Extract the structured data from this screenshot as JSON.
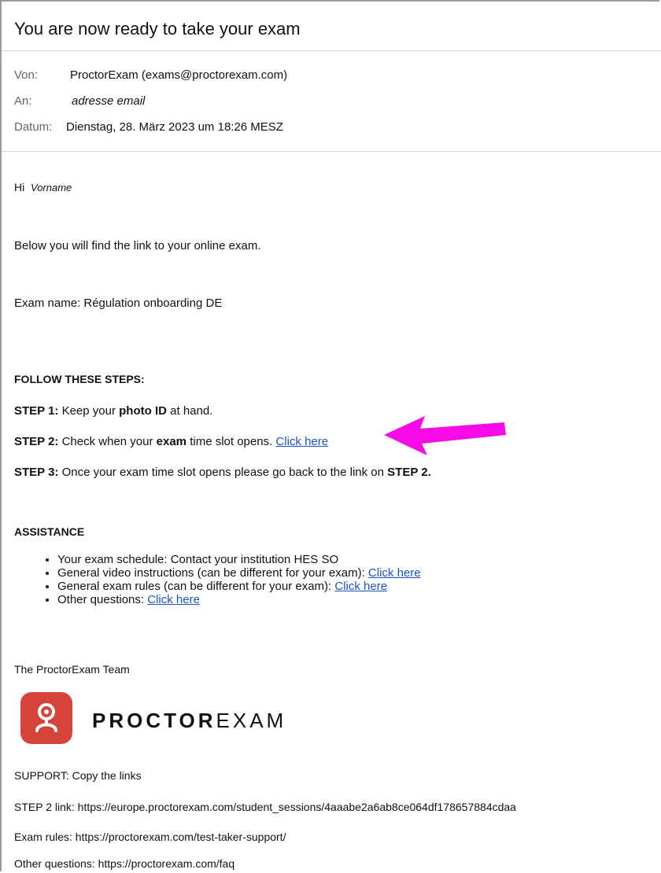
{
  "email": {
    "subject": "You are now ready to take your exam",
    "headers": {
      "from_label": "Von:",
      "from_value": "ProctorExam (exams@proctorexam.com)",
      "to_label": "An:",
      "to_value": "adresse email",
      "date_label": "Datum:",
      "date_value": "Dienstag, 28. März 2023 um 18:26 MESZ"
    },
    "body": {
      "greeting_prefix": "Hi",
      "greeting_name": "Vorname",
      "intro": "Below you will find the link to your online exam.",
      "exam_name": "Exam name: Régulation onboarding DE",
      "steps_heading": "FOLLOW THESE STEPS:",
      "step1": {
        "label": "STEP 1:",
        "text_before": " Keep your ",
        "bold": "photo ID",
        "text_after": " at hand."
      },
      "step2": {
        "label": "STEP 2:",
        "text_before": " Check when your ",
        "bold": "exam",
        "text_after": " time slot opens. ",
        "link": "Click here"
      },
      "step3": {
        "label": "STEP 3:",
        "text_before": " Once your exam time slot opens please go back to the link on ",
        "bold": "STEP 2."
      },
      "assistance_heading": "ASSISTANCE",
      "assistance_items": [
        {
          "text": "Your exam schedule: Contact your institution HES SO",
          "link": ""
        },
        {
          "text": "General video instructions (can be different for your exam): ",
          "link": "Click here"
        },
        {
          "text": "General exam rules (can be different for your exam): ",
          "link": "Click here"
        },
        {
          "text": "Other questions: ",
          "link": "Click here"
        }
      ],
      "signoff": "The ProctorExam Team",
      "logo": {
        "bold_part": "PROCTOR",
        "light_part": "EXAM",
        "brand_color": "#d6433b",
        "icon": "proctor-person-icon"
      },
      "support_heading": "SUPPORT: Copy the links",
      "support_lines": {
        "step2_link": "STEP 2 link: https://europe.proctorexam.com/student_sessions/4aaabe2a6ab8ce064df178657884cdaa",
        "exam_rules": "Exam rules: https://proctorexam.com/test-taker-support/",
        "other_questions": "Other questions: https://proctorexam.com/faq"
      }
    },
    "colors": {
      "link": "#1a56c4",
      "arrow": "#f60ae6"
    }
  }
}
